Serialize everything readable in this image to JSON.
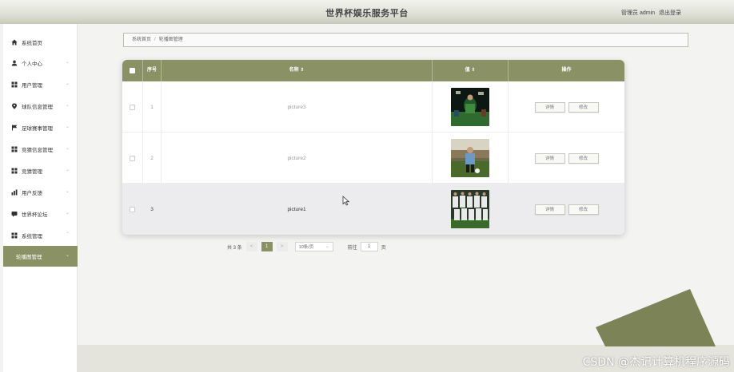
{
  "app": {
    "title": "世界杯娱乐服务平台"
  },
  "header": {
    "role_user": "管理员 admin",
    "logout": "退出登录"
  },
  "sidebar": {
    "items": [
      {
        "label": "系统首页",
        "icon": "home-icon",
        "arrow": ""
      },
      {
        "label": "个人中心",
        "icon": "person-icon",
        "arrow": "⌄"
      },
      {
        "label": "用户管理",
        "icon": "grid-icon",
        "arrow": "⌄"
      },
      {
        "label": "球队信息管理",
        "icon": "location-icon",
        "arrow": "⌄"
      },
      {
        "label": "足球赛事管理",
        "icon": "flag-icon",
        "arrow": "⌄"
      },
      {
        "label": "竞猜信息管理",
        "icon": "grid-icon",
        "arrow": "⌄"
      },
      {
        "label": "竞猜管理",
        "icon": "grid-icon",
        "arrow": "⌄"
      },
      {
        "label": "用户反馈",
        "icon": "chart-icon",
        "arrow": "⌄"
      },
      {
        "label": "世界杯论坛",
        "icon": "chat-icon",
        "arrow": "⌄"
      },
      {
        "label": "系统管理",
        "icon": "grid-icon",
        "arrow": "⌃"
      },
      {
        "label": "轮播图管理",
        "icon": "",
        "arrow": "⌄"
      }
    ]
  },
  "breadcrumb": {
    "home": "系统首页",
    "separator": "/",
    "current": "轮播图管理"
  },
  "table": {
    "headers": {
      "index": "序号",
      "name": "名称 ⇕",
      "value": "值 ⇕",
      "actions": "操作"
    },
    "rows": [
      {
        "index": "1",
        "name": "picture3",
        "detail": "详情",
        "edit": "修改"
      },
      {
        "index": "2",
        "name": "picture2",
        "detail": "详情",
        "edit": "修改"
      },
      {
        "index": "3",
        "name": "picture1",
        "detail": "详情",
        "edit": "修改"
      }
    ]
  },
  "pagination": {
    "total": "共 3 条",
    "prev": "<",
    "current": "1",
    "next": ">",
    "page_size": "10条/页",
    "goto_label": "前往",
    "goto_value": "1",
    "goto_unit": "页"
  },
  "watermark": "CSDN @杰记计算机程序源码",
  "colors": {
    "accent": "#8a9265",
    "deco": "#7c8356"
  }
}
